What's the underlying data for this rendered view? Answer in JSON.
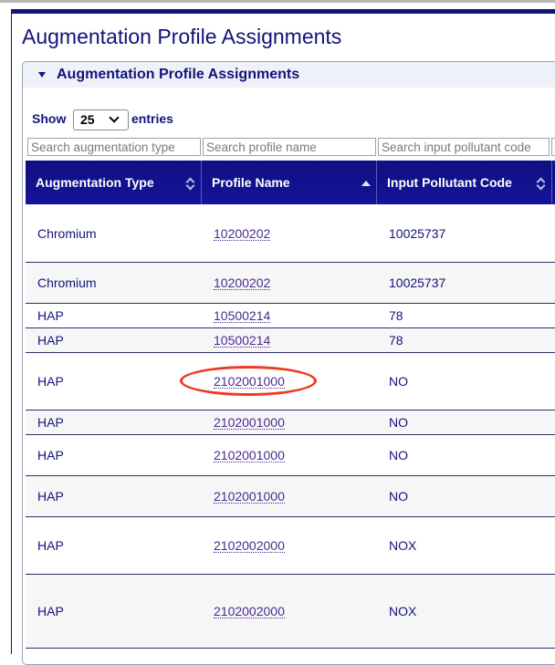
{
  "page_title": "Augmentation Profile Assignments",
  "panel": {
    "title": "Augmentation Profile Assignments"
  },
  "length_control": {
    "show_label": "Show",
    "value": "25",
    "entries_label": "entries"
  },
  "filters": {
    "augmentation_type_placeholder": "Search augmentation type",
    "profile_name_placeholder": "Search profile name",
    "input_pollutant_placeholder": "Search input pollutant code"
  },
  "table": {
    "columns": [
      "Augmentation Type",
      "Profile Name",
      "Input Pollutant Code"
    ],
    "rows": [
      {
        "type": "Chromium",
        "profile": "10200202",
        "pollutant": "10025737"
      },
      {
        "type": "Chromium",
        "profile": "10200202",
        "pollutant": "10025737"
      },
      {
        "type": "HAP",
        "profile": "10500214",
        "pollutant": "78"
      },
      {
        "type": "HAP",
        "profile": "10500214",
        "pollutant": "78"
      },
      {
        "type": "HAP",
        "profile": "2102001000",
        "pollutant": "NO"
      },
      {
        "type": "HAP",
        "profile": "2102001000",
        "pollutant": "NO"
      },
      {
        "type": "HAP",
        "profile": "2102001000",
        "pollutant": "NO"
      },
      {
        "type": "HAP",
        "profile": "2102001000",
        "pollutant": "NO"
      },
      {
        "type": "HAP",
        "profile": "2102002000",
        "pollutant": "NOX"
      },
      {
        "type": "HAP",
        "profile": "2102002000",
        "pollutant": "NOX"
      }
    ]
  },
  "colors": {
    "accent": "#13137a",
    "header": "#14149a",
    "link": "#4a2b91",
    "highlight": "#ef3a22"
  }
}
